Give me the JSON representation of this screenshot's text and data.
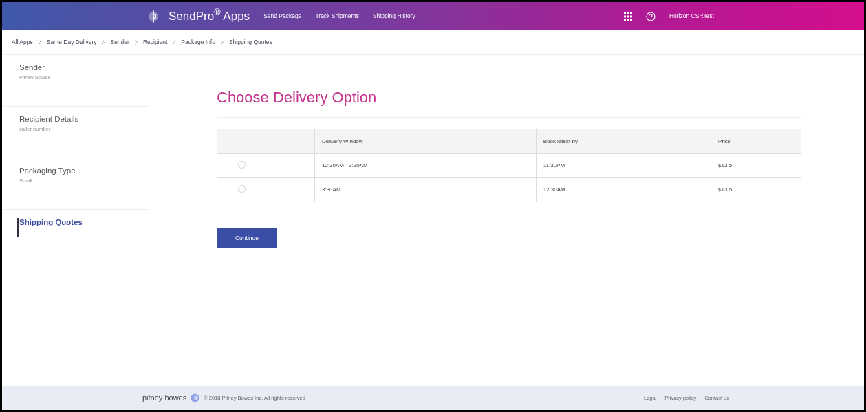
{
  "header": {
    "brand": "SendPro",
    "brand_mark": "®",
    "brand_suffix": "Apps",
    "nav": [
      "Send Package",
      "Track Shipments",
      "Shipping History"
    ],
    "user": "Horizon CSRTest"
  },
  "breadcrumbs": [
    "All Apps",
    "Same Day Delivery",
    "Sender",
    "Recipient",
    "Package Info",
    "Shipping Quotes"
  ],
  "sidebar": {
    "items": [
      {
        "title": "Sender",
        "subtitle": "Pitney Bowes",
        "selected": false
      },
      {
        "title": "Recipient Details",
        "subtitle": "caller number",
        "selected": false
      },
      {
        "title": "Packaging Type",
        "subtitle": "Small",
        "selected": false
      },
      {
        "title": "Shipping Quotes",
        "selected": true
      }
    ]
  },
  "main": {
    "title": "Choose Delivery Option",
    "table": {
      "columns": [
        "Delivery Window",
        "Book latest by",
        "Price"
      ],
      "rows": [
        {
          "selected": false,
          "cells": [
            "12:30AM - 3:30AM",
            "11:30PM",
            "$13.5"
          ]
        },
        {
          "selected": false,
          "cells": [
            "3:30AM",
            "12:30AM",
            "$13.5"
          ]
        }
      ]
    },
    "button": "Continue"
  },
  "footer": {
    "logo": "pitney bowes",
    "copyright": "© 2018 Pitney Bowes Inc. All rights reserved",
    "links": [
      "Legal",
      "Privacy policy",
      "Contact us"
    ]
  }
}
